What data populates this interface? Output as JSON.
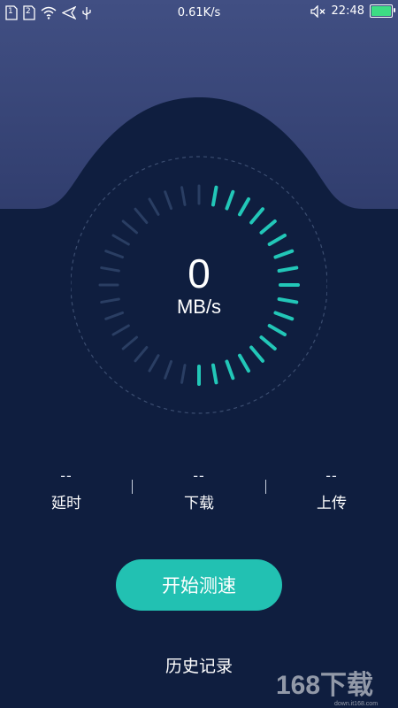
{
  "status_bar": {
    "sim1": "1",
    "sim2": "2",
    "network_speed": "0.61K/s",
    "time": "22:48",
    "icons": [
      "sim-card-icon",
      "wifi-icon",
      "location-arrow-icon",
      "usb-icon",
      "mute-icon",
      "battery-icon"
    ],
    "battery_level": 1.0
  },
  "gauge": {
    "value": "0",
    "unit": "MB/s",
    "accent_color": "#22c7b8",
    "inactive_color": "#2a3e63"
  },
  "stats": [
    {
      "value": "--",
      "label": "延时"
    },
    {
      "value": "--",
      "label": "下载"
    },
    {
      "value": "--",
      "label": "上传"
    }
  ],
  "actions": {
    "start_label": "开始测速",
    "history_label": "历史记录"
  },
  "watermark": {
    "brand": "168下载",
    "url": "down.it168.com"
  }
}
